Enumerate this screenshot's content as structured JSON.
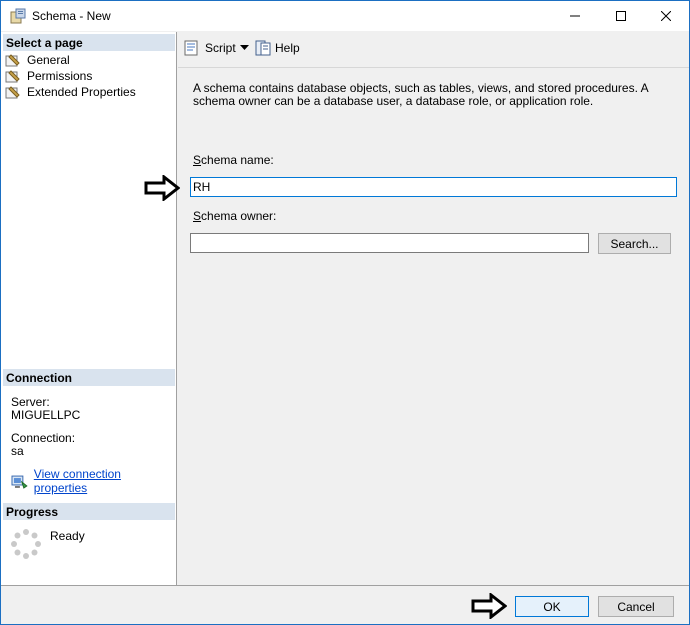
{
  "window": {
    "title": "Schema - New"
  },
  "left": {
    "select_page_header": "Select a page",
    "pages": [
      "General",
      "Permissions",
      "Extended Properties"
    ],
    "connection_header": "Connection",
    "server_label": "Server:",
    "server_value": "MIGUELLPC",
    "connection_label": "Connection:",
    "connection_value": "sa",
    "view_connection_link": "View connection properties",
    "progress_header": "Progress",
    "progress_status": "Ready"
  },
  "toolbar": {
    "script_label": "Script",
    "help_label": "Help"
  },
  "main": {
    "description": "A schema contains database objects, such as tables, views, and stored procedures. A schema owner can be a database user, a database role, or application role.",
    "schema_name_label_first": "S",
    "schema_name_label_rest": "chema name:",
    "schema_name_value": "RH",
    "schema_owner_label_first": "S",
    "schema_owner_label_rest": "chema owner:",
    "schema_owner_value": "",
    "search_button_first": "Search",
    "search_button_rest": "..."
  },
  "footer": {
    "ok_label": "OK",
    "cancel_label": "Cancel"
  },
  "colors": {
    "accent": "#0078d7",
    "header_bg": "#d9e3ee",
    "link": "#0044cc"
  }
}
